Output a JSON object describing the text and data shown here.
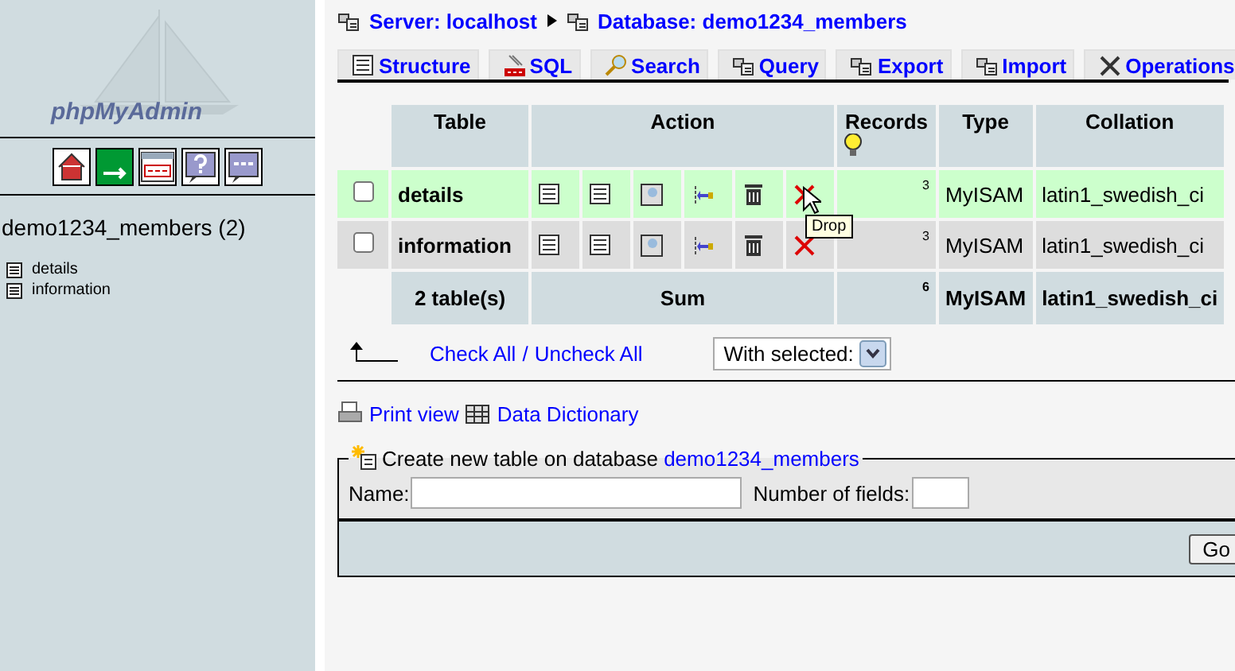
{
  "sidebar": {
    "logo": "phpMyAdmin",
    "database": "demo1234_members (2)",
    "tables": [
      {
        "name": "details"
      },
      {
        "name": "information"
      }
    ]
  },
  "breadcrumb": {
    "server": "Server: localhost",
    "database": "Database: demo1234_members"
  },
  "tabs": [
    {
      "label": "Structure",
      "selected": false
    },
    {
      "label": "SQL",
      "selected": false
    },
    {
      "label": "Search",
      "selected": false
    },
    {
      "label": "Query",
      "selected": false
    },
    {
      "label": "Export",
      "selected": false
    },
    {
      "label": "Import",
      "selected": false
    },
    {
      "label": "Operations",
      "selected": false
    }
  ],
  "table": {
    "columns": [
      "Table",
      "Action",
      "Records",
      "Type",
      "Collation"
    ],
    "rows": [
      {
        "name": "details",
        "checked": false,
        "highlighted": true,
        "records": "3",
        "type": "MyISAM",
        "collation": "latin1_swedish_ci"
      },
      {
        "name": "information",
        "checked": false,
        "highlighted": false,
        "records": "3",
        "type": "MyISAM",
        "collation": "latin1_swedish_ci"
      }
    ],
    "summary": {
      "name": "2 table(s)",
      "action": "Sum",
      "records": "6",
      "type": "MyISAM",
      "collation": "latin1_swedish_ci"
    }
  },
  "tooltip": "Drop",
  "bulk": {
    "check_all": "Check All",
    "separator": "/",
    "uncheck_all": "Uncheck All",
    "with_selected": "With selected:"
  },
  "links": [
    "Print view",
    "Data Dictionary"
  ],
  "create": {
    "legend": "Create new table on database",
    "database": "demo1234_members",
    "name_label": "Name:",
    "fields_label": "Number of fields:",
    "button": "Go"
  }
}
